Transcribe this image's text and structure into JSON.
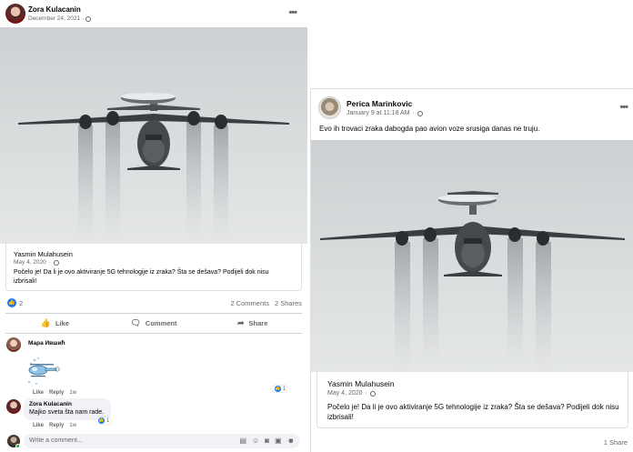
{
  "left_post": {
    "author": "Zora Kulacanin",
    "date": "December 24, 2021",
    "more": "•••",
    "shared": {
      "author": "Yasmin Mulahusein",
      "date": "May 4, 2020",
      "text": "Počelo je! Da li je ovo aktiviranje 5G tehnologije iz zraka? Šta se dešava? Podijeli dok nisu izbrisali!"
    },
    "reactions_count": "2",
    "comments_count": "2 Comments",
    "shares_count": "2 Shares",
    "actions": {
      "like": "Like",
      "comment": "Comment",
      "share": "Share"
    },
    "comments": [
      {
        "author": "Мара Ившић",
        "text": "",
        "like": "Like",
        "reply": "Reply",
        "time": "1w",
        "reactions": "1"
      },
      {
        "author": "Zora Kulacanin",
        "text": "Majko sveta šta nam rade.",
        "like": "Like",
        "reply": "Reply",
        "time": "1w",
        "reactions": "1"
      }
    ],
    "write_placeholder": "Write a comment..."
  },
  "right_post": {
    "author": "Perica Marinkovic",
    "date": "January 9 at 11:18 AM",
    "more": "•••",
    "text": "Evo ih trovaci zraka  dabogda pao avion voze srusiga danas ne truju.",
    "shared": {
      "author": "Yasmin Mulahusein",
      "date": "May 4, 2020",
      "text": "Počelo je! Da li je ovo aktiviranje 5G tehnologije iz zraka? Šta se dešava? Podijeli dok nisu izbrisali!"
    },
    "shares_count": "1 Share"
  },
  "icons": {
    "globe": "globe-icon",
    "like": "thumbs-up-icon",
    "comment": "speech-bubble-icon",
    "share": "share-arrow-icon",
    "more": "more-horizontal-icon"
  },
  "colors": {
    "accent": "#1877f2",
    "secondary_text": "#65676b",
    "online": "#31a24c"
  }
}
